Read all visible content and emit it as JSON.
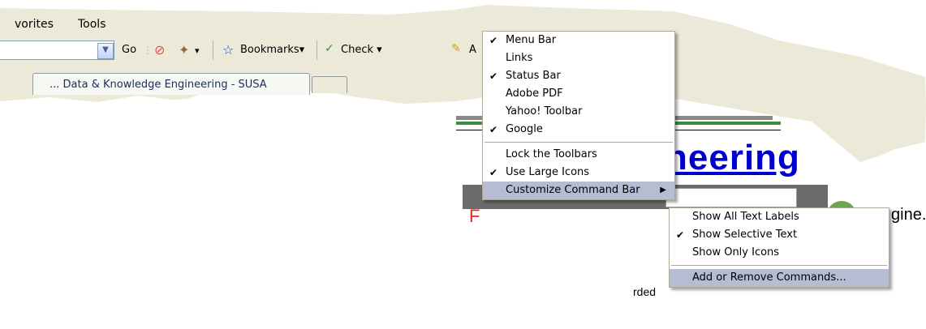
{
  "menubar": {
    "favorites": "vorites",
    "tools": "Tools"
  },
  "toolbar": {
    "go": "Go",
    "bookmarks": "Bookmarks",
    "bookmarks_arrow": "▾",
    "check": "Check",
    "check_arrow": "▾",
    "more_letter": "A"
  },
  "tab": {
    "title": "... Data & Knowledge Engineering - SUSA"
  },
  "page": {
    "heading": "neering",
    "red_letter": "F",
    "engine_text": "gine.",
    "ded_text": "rded"
  },
  "context_menu": {
    "items": [
      {
        "label": "Menu Bar",
        "checked": true
      },
      {
        "label": "Links",
        "checked": false
      },
      {
        "label": "Status Bar",
        "checked": true
      },
      {
        "label": "Adobe PDF",
        "checked": false
      },
      {
        "label": "Yahoo! Toolbar",
        "checked": false
      },
      {
        "label": "Google",
        "checked": true
      },
      {
        "label": "Lock the Toolbars",
        "checked": false
      },
      {
        "label": "Use Large Icons",
        "checked": true
      },
      {
        "label": "Customize Command Bar",
        "checked": false,
        "submenu": true,
        "highlighted": true
      }
    ]
  },
  "submenu": {
    "items": [
      {
        "label": "Show All Text Labels",
        "checked": false
      },
      {
        "label": "Show Selective Text",
        "checked": true
      },
      {
        "label": "Show Only Icons",
        "checked": false
      },
      {
        "label": "Add or Remove Commands...",
        "checked": false,
        "highlighted": true
      }
    ]
  },
  "icons": {
    "check": "✔",
    "submenu_arrow": "▶",
    "dropdown": "▾"
  }
}
